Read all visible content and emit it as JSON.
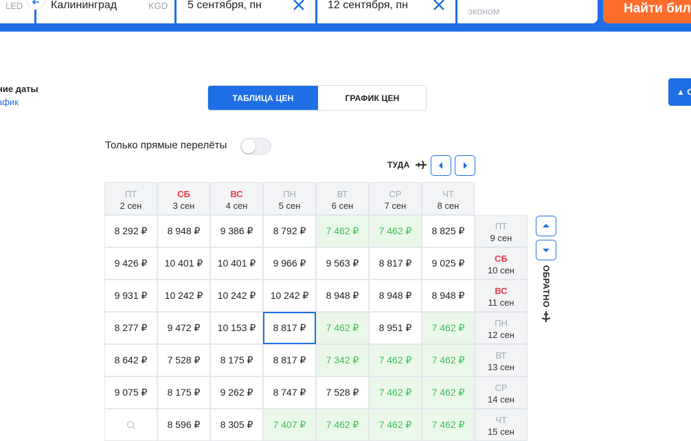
{
  "search": {
    "origin_code": "LED",
    "destination": "Калининград",
    "destination_code": "KGD",
    "depart_date": "5 сентября, пн",
    "return_date": "12 сентября, пн",
    "class": "эконом",
    "find_button": "Найти билеты"
  },
  "left_panel": {
    "title": "ние даты",
    "link": "афик"
  },
  "tabs": [
    {
      "label": "ТАБЛИЦА ЦЕН",
      "active": true
    },
    {
      "label": "ГРАФИК ЦЕН",
      "active": false
    }
  ],
  "right_button": "▲ О",
  "direct_only": {
    "label": "Только прямые перелёты",
    "on": false
  },
  "outbound_label": "ТУДА",
  "return_label": "ОБРАТНО",
  "columns": [
    {
      "dow": "ПТ",
      "date": "2 сен",
      "weekend": false
    },
    {
      "dow": "СБ",
      "date": "3 сен",
      "weekend": true
    },
    {
      "dow": "ВС",
      "date": "4 сен",
      "weekend": true
    },
    {
      "dow": "ПН",
      "date": "5 сен",
      "weekend": false
    },
    {
      "dow": "ВТ",
      "date": "6 сен",
      "weekend": false
    },
    {
      "dow": "СР",
      "date": "7 сен",
      "weekend": false
    },
    {
      "dow": "ЧТ",
      "date": "8 сен",
      "weekend": false
    }
  ],
  "rows": [
    {
      "dow": "ПТ",
      "date": "9 сен",
      "weekend": false,
      "prices": [
        "8 292 ₽",
        "8 948 ₽",
        "9 386 ₽",
        "8 792 ₽",
        "7 462 ₽",
        "7 462 ₽",
        "8 825 ₽"
      ],
      "cheap": [
        false,
        false,
        false,
        false,
        true,
        true,
        false
      ]
    },
    {
      "dow": "СБ",
      "date": "10 сен",
      "weekend": true,
      "prices": [
        "9 426 ₽",
        "10 401 ₽",
        "10 401 ₽",
        "9 966 ₽",
        "9 563 ₽",
        "8 817 ₽",
        "9 025 ₽"
      ],
      "cheap": [
        false,
        false,
        false,
        false,
        false,
        false,
        false
      ]
    },
    {
      "dow": "ВС",
      "date": "11 сен",
      "weekend": true,
      "prices": [
        "9 931 ₽",
        "10 242 ₽",
        "10 242 ₽",
        "10 242 ₽",
        "8 948 ₽",
        "8 948 ₽",
        "8 948 ₽"
      ],
      "cheap": [
        false,
        false,
        false,
        false,
        false,
        false,
        false
      ]
    },
    {
      "dow": "ПН",
      "date": "12 сен",
      "weekend": false,
      "prices": [
        "8 277 ₽",
        "9 472 ₽",
        "10 153 ₽",
        "8 817 ₽",
        "7 462 ₽",
        "8 951 ₽",
        "7 462 ₽"
      ],
      "cheap": [
        false,
        false,
        false,
        false,
        true,
        false,
        true
      ]
    },
    {
      "dow": "ВТ",
      "date": "13 сен",
      "weekend": false,
      "prices": [
        "8 642 ₽",
        "7 528 ₽",
        "8 175 ₽",
        "8 817 ₽",
        "7 342 ₽",
        "7 462 ₽",
        "7 462 ₽"
      ],
      "cheap": [
        false,
        false,
        false,
        false,
        true,
        true,
        true
      ]
    },
    {
      "dow": "СР",
      "date": "14 сен",
      "weekend": false,
      "prices": [
        "9 075 ₽",
        "8 175 ₽",
        "9 262 ₽",
        "8 747 ₽",
        "7 528 ₽",
        "7 462 ₽",
        "7 462 ₽"
      ],
      "cheap": [
        false,
        false,
        false,
        false,
        false,
        true,
        true
      ]
    },
    {
      "dow": "ЧТ",
      "date": "15 сен",
      "weekend": false,
      "prices": [
        "",
        "8 596 ₽",
        "8 305 ₽",
        "7 407 ₽",
        "7 462 ₽",
        "7 462 ₽",
        "7 462 ₽"
      ],
      "cheap": [
        false,
        false,
        false,
        true,
        true,
        true,
        true
      ]
    }
  ],
  "selected": {
    "row": 3,
    "col": 3
  }
}
